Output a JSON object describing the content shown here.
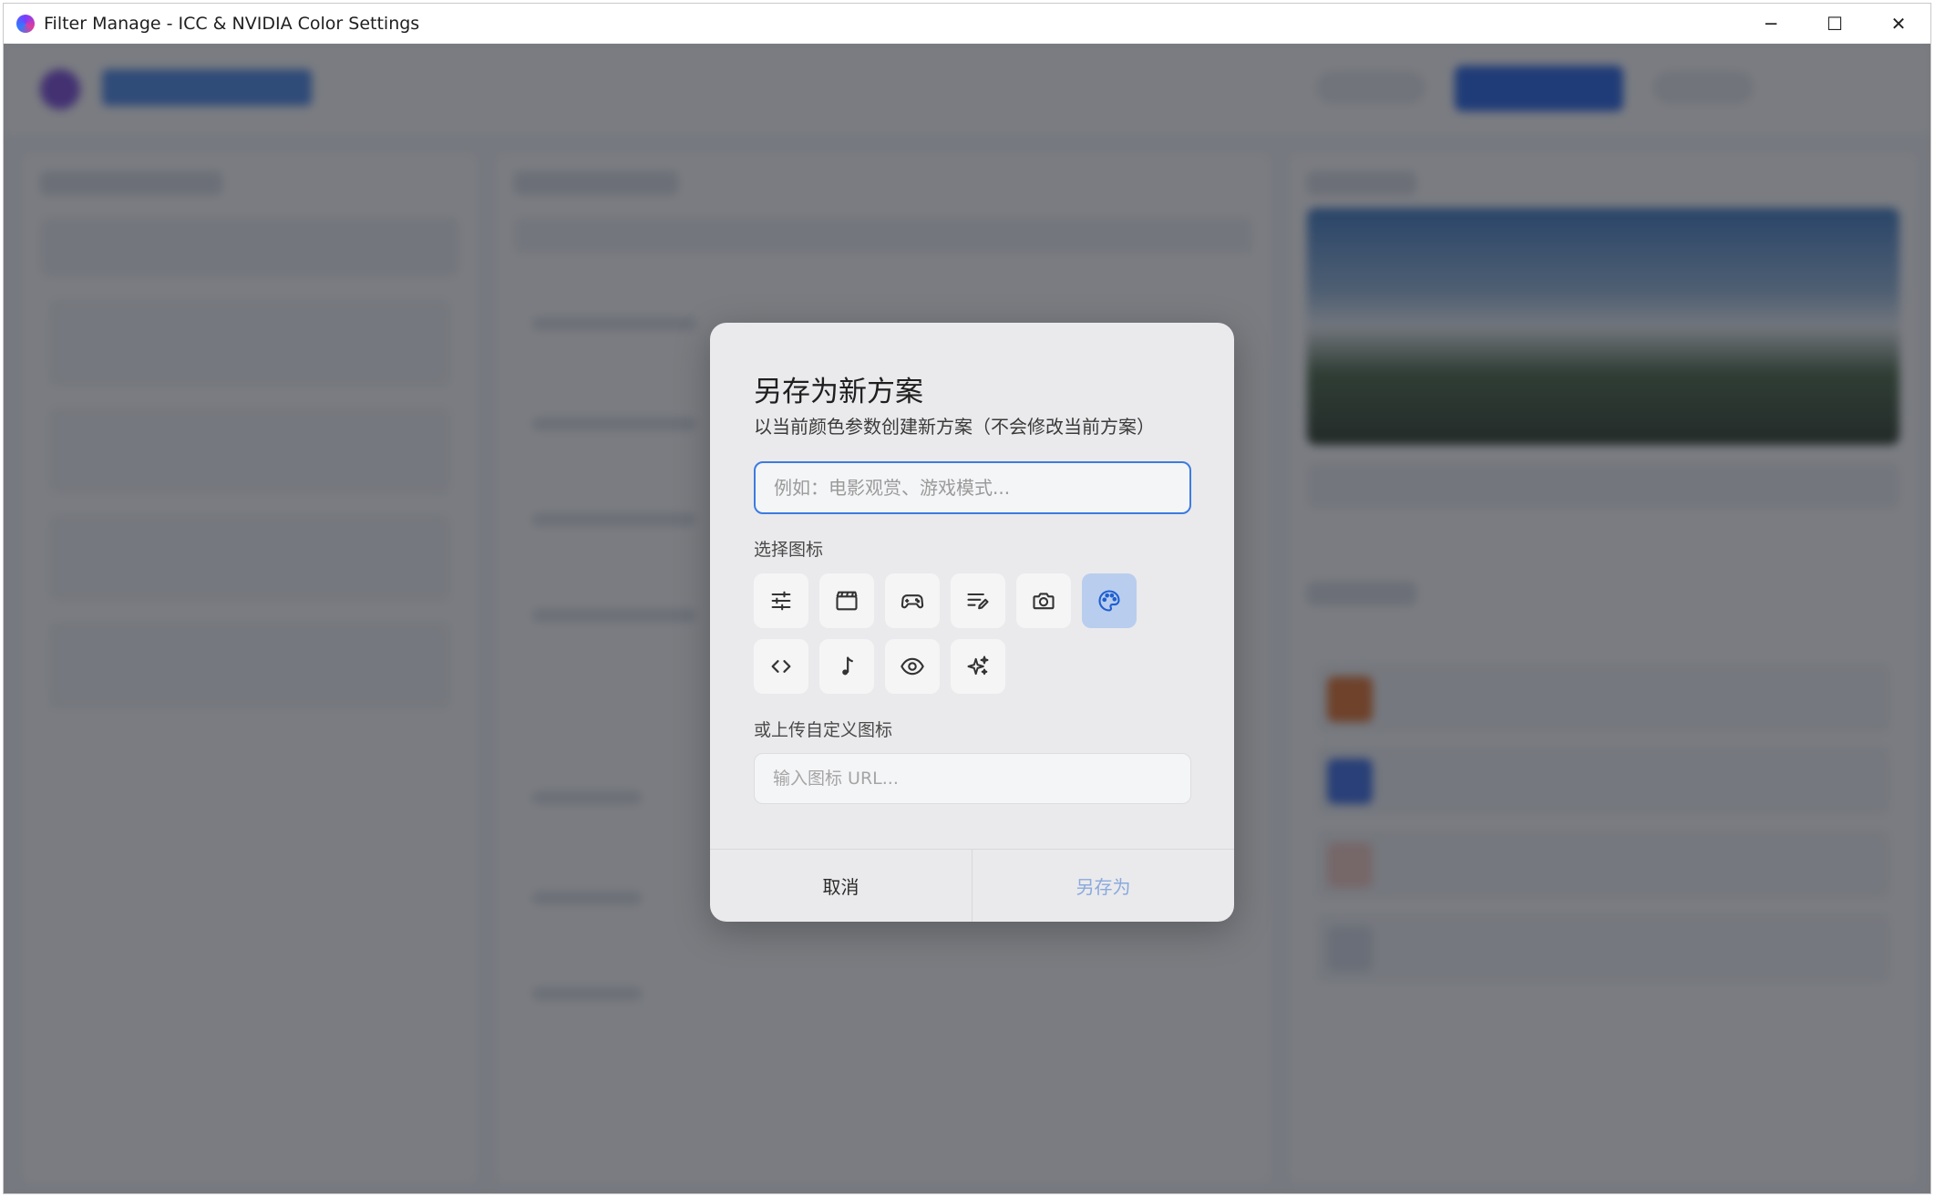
{
  "window": {
    "title": "Filter Manage - ICC & NVIDIA Color Settings",
    "controls": {
      "minimize": "─",
      "maximize": "☐",
      "close": "✕"
    }
  },
  "dialog": {
    "title": "另存为新方案",
    "subtitle": "以当前颜色参数创建新方案（不会修改当前方案）",
    "name_placeholder": "例如：电影观赏、游戏模式...",
    "name_value": "",
    "icon_section_label": "选择图标",
    "icons": [
      "sliders-icon",
      "clapperboard-icon",
      "gamepad-icon",
      "edit-list-icon",
      "camera-icon",
      "palette-icon",
      "code-icon",
      "music-note-icon",
      "eye-icon",
      "sparkles-icon"
    ],
    "selected_icon": "palette-icon",
    "custom_icon_label": "或上传自定义图标",
    "url_placeholder": "输入图标 URL...",
    "cancel_label": "取消",
    "confirm_label": "另存为"
  },
  "colors": {
    "accent": "#3c7be0",
    "selected_icon_bg": "#b9cdee",
    "disabled_confirm": "#8aa9dc",
    "overlay": "rgba(40,44,52,0.62)"
  }
}
